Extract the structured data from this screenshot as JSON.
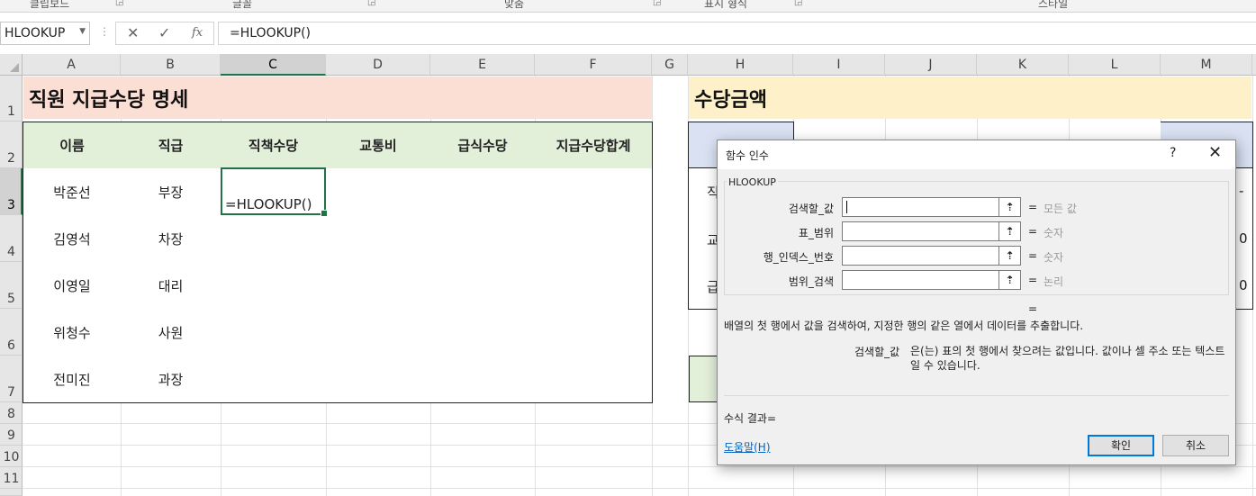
{
  "ribbon": {
    "groups": [
      "클립보드",
      "글꼴",
      "맞춤",
      "표시 형식",
      "스타일"
    ]
  },
  "formula_bar": {
    "name_box": "HLOOKUP",
    "cancel_icon": "✕",
    "enter_icon": "✓",
    "fx_icon": "fx",
    "formula": "=HLOOKUP()"
  },
  "columns": [
    "A",
    "B",
    "C",
    "D",
    "E",
    "F",
    "G",
    "H",
    "I",
    "J",
    "K",
    "L",
    "M"
  ],
  "rows": [
    "1",
    "2",
    "3",
    "4",
    "5",
    "6",
    "7",
    "8",
    "9",
    "10",
    "11"
  ],
  "sheet": {
    "title1": "직원 지급수당 명세",
    "title2": "수당금액",
    "headers": [
      "이름",
      "직급",
      "직책수당",
      "교통비",
      "급식수당",
      "지급수당합계"
    ],
    "employees": [
      {
        "name": "박준선",
        "rank": "부장"
      },
      {
        "name": "김영석",
        "rank": "차장"
      },
      {
        "name": "이영일",
        "rank": "대리"
      },
      {
        "name": "위청수",
        "rank": "사원"
      },
      {
        "name": "전미진",
        "rank": "과장"
      }
    ],
    "active_cell": "=HLOOKUP()",
    "right_fragments": {
      "row3_left": "직",
      "row4_left": "교",
      "row5_left": "급",
      "row3_right": "-",
      "row4_right": "0",
      "row5_right": "0"
    }
  },
  "dialog": {
    "title": "함수 인수",
    "help": "?",
    "close": "✕",
    "function_name": "HLOOKUP",
    "args": [
      {
        "label": "검색할_값",
        "value": "모든 값"
      },
      {
        "label": "표_범위",
        "value": "숫자"
      },
      {
        "label": "행_인덱스_번호",
        "value": "숫자"
      },
      {
        "label": "범위_검색",
        "value": "논리"
      }
    ],
    "equals": "=",
    "description": "배열의 첫 행에서 값을 검색하여, 지정한 행의 같은 열에서 데이터를 추출합니다.",
    "arg_name": "검색할_값",
    "arg_description": "은(는) 표의 첫 행에서 찾으려는 값입니다. 값이나 셀 주소 또는 텍스트일 수 있습니다.",
    "result_label": "수식 결과=",
    "help_link": "도움말(H)",
    "ok": "확인",
    "cancel": "취소"
  }
}
